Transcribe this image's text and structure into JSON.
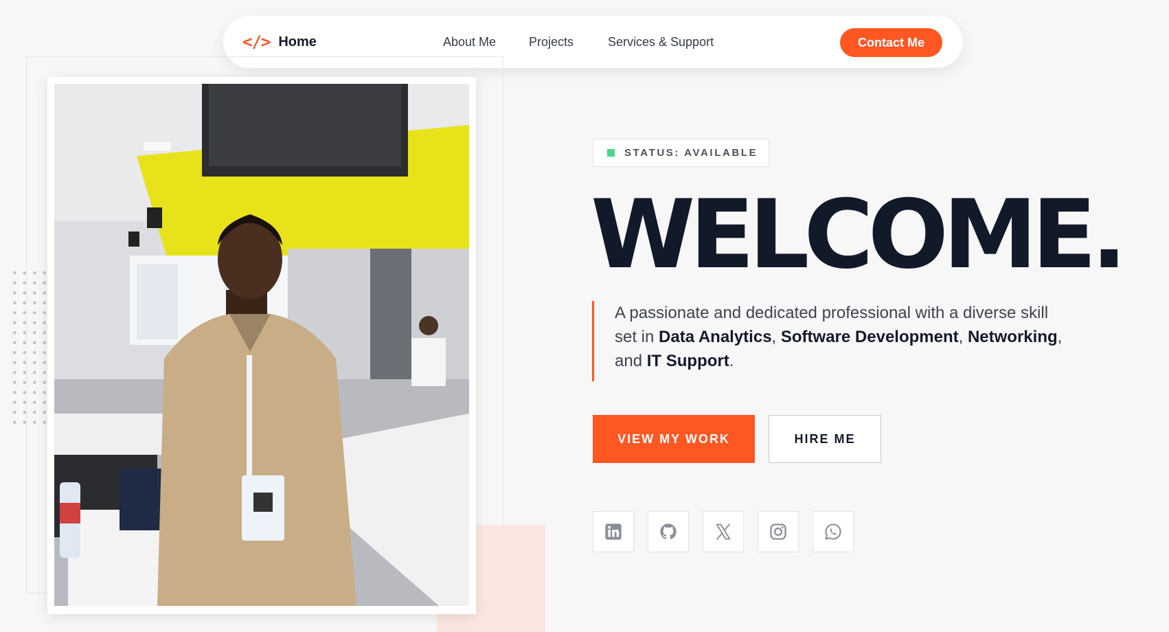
{
  "nav": {
    "brand_icon": "</>",
    "brand_label": "Home",
    "links": [
      "About Me",
      "Projects",
      "Services & Support"
    ],
    "contact_label": "Contact Me"
  },
  "hero": {
    "status": "STATUS: AVAILABLE",
    "headline": "WELCOME.",
    "intro_parts": [
      "A passionate and dedicated professional with a diverse skill set in ",
      "Data Analytics",
      ", ",
      "Software Development",
      ", ",
      "Networking",
      ", and ",
      "IT Support",
      "."
    ],
    "primary_button": "VIEW MY WORK",
    "secondary_button": "HIRE ME",
    "socials": [
      "linkedin-icon",
      "github-icon",
      "x-icon",
      "instagram-icon",
      "whatsapp-icon"
    ]
  },
  "colors": {
    "accent": "#ff5722",
    "status_green": "#4cd68b",
    "heading": "#121929",
    "background": "#f7f7f8"
  }
}
